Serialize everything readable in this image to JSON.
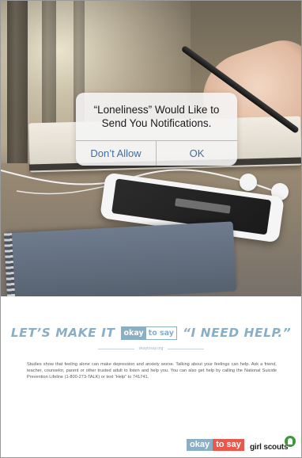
{
  "alert": {
    "title_line1": "“Loneliness” Would Like to",
    "title_line2": "Send You Notifications.",
    "dont_allow_label": "Don’t Allow",
    "ok_label": "OK"
  },
  "campaign": {
    "headline_before": "LET’S MAKE IT",
    "badge_okay": "okay",
    "badge_to_say": "to say",
    "headline_after": "“I NEED HELP.”",
    "url": "okaytosay.org",
    "body": "Studies show that feeling alone can make depression and anxiety worse. Talking about your feelings can help. Ask a friend, teacher, counselor, parent or other trusted adult to listen and help you. You can also get help by calling the National Suicide Prevention Lifeline (1-800-273-TALK) or text “Help” to 741741."
  },
  "logos": {
    "okay_part": "okay",
    "to_say_part": "to say",
    "girl_scouts": "girl scouts"
  },
  "colors": {
    "headline_blue": "#8aaec4",
    "alert_button_blue": "#3f6ea8",
    "to_say_red": "#e8594b",
    "girl_scouts_green": "#3a9a3a"
  },
  "icons": {
    "girl_scouts_mark": "trefoil-icon"
  }
}
